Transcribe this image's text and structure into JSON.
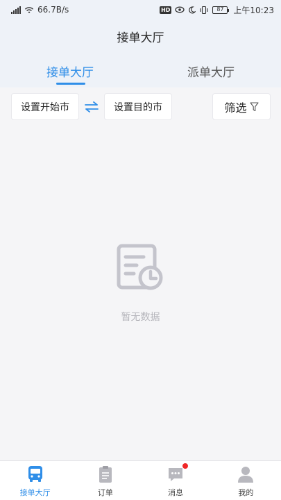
{
  "status_bar": {
    "network_speed": "66.7B/s",
    "battery": "87",
    "time": "上午10:23"
  },
  "header": {
    "title": "接单大厅"
  },
  "tabs": [
    {
      "label": "接单大厅",
      "active": true
    },
    {
      "label": "派单大厅",
      "active": false
    }
  ],
  "filters": {
    "start_city": "设置开始市",
    "dest_city": "设置目的市",
    "filter_label": "筛选"
  },
  "empty_state": {
    "text": "暂无数据"
  },
  "tabbar": {
    "items": [
      {
        "label": "接单大厅",
        "icon": "bus-icon",
        "active": true
      },
      {
        "label": "订单",
        "icon": "clipboard-icon",
        "active": false
      },
      {
        "label": "消息",
        "icon": "chat-icon",
        "active": false,
        "badge": true
      },
      {
        "label": "我的",
        "icon": "person-icon",
        "active": false
      }
    ]
  },
  "colors": {
    "accent": "#2f8ee8",
    "badge": "#f02727",
    "header_bg": "#eef2f8"
  }
}
